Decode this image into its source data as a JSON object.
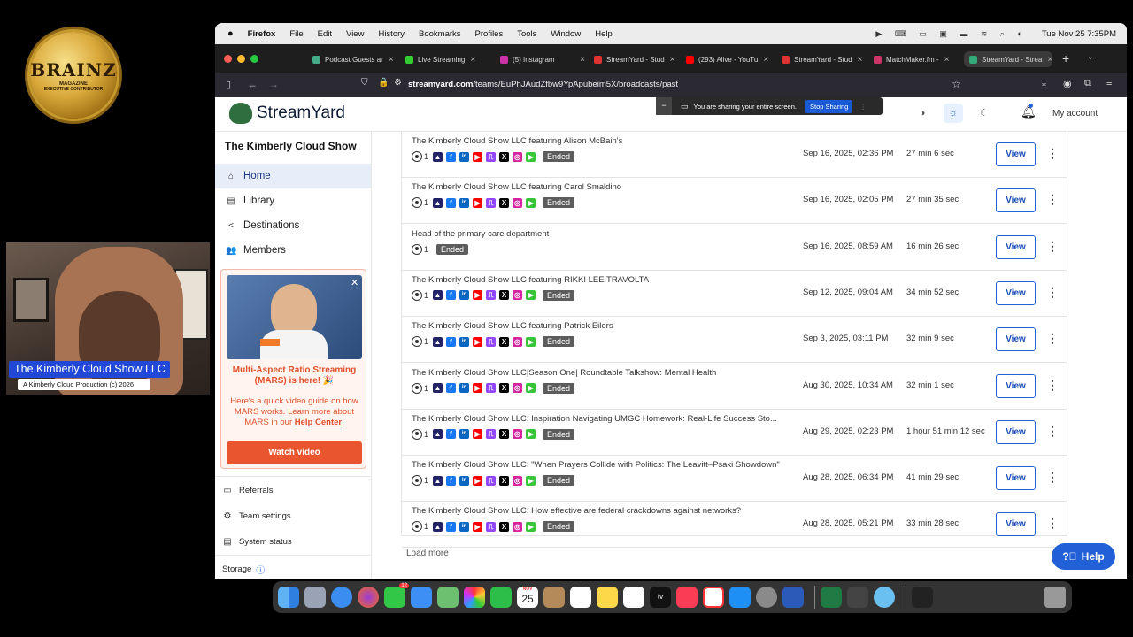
{
  "overlay": {
    "badge_title": "BRAINZ",
    "badge_line1": "MAGAZINE",
    "badge_line2": "EXECUTIVE CONTRIBUTOR",
    "lower_third_name": "The Kimberly Cloud Show LLC",
    "lower_third_sub": "A Kimberly Cloud Production (c) 2026"
  },
  "menubar": {
    "app": "Firefox",
    "items": [
      "File",
      "Edit",
      "View",
      "History",
      "Bookmarks",
      "Profiles",
      "Tools",
      "Window",
      "Help"
    ],
    "datetime": "Tue Nov 25  7:35PM"
  },
  "tabs": [
    {
      "label": "Podcast Guests ar",
      "color": "#4a8"
    },
    {
      "label": "Live Streaming",
      "color": "#3c3"
    },
    {
      "label": "(5) Instagram",
      "color": "#c3a"
    },
    {
      "label": "StreamYard - Stud",
      "color": "#d33"
    },
    {
      "label": "(293) Alive - YouTu",
      "color": "#f00"
    },
    {
      "label": "StreamYard - Stud",
      "color": "#d33"
    },
    {
      "label": "MatchMaker.fm - ",
      "color": "#c36"
    },
    {
      "label": "StreamYard - Strea",
      "color": "#3a7"
    }
  ],
  "url": {
    "domain": "streamyard.com",
    "path": "/teams/EuPhJAudZfbw9YpApubeim5X/broadcasts/past"
  },
  "header": {
    "logo_text": "StreamYard",
    "share_text": "You are sharing your entire screen.",
    "stop_sharing": "Stop Sharing",
    "my_account": "My account"
  },
  "sidebar": {
    "show_name": "The Kimberly Cloud Show",
    "nav": [
      {
        "label": "Home",
        "icon": "home-icon",
        "glyph": "⌂"
      },
      {
        "label": "Library",
        "icon": "library-icon",
        "glyph": "▤"
      },
      {
        "label": "Destinations",
        "icon": "share-icon",
        "glyph": "<"
      },
      {
        "label": "Members",
        "icon": "members-icon",
        "glyph": "👥"
      }
    ],
    "promo": {
      "title": "Multi-Aspect Ratio Streaming (MARS) is here! 🎉",
      "desc_pre": "Here's a quick video guide on how MARS works. Learn more about MARS in our ",
      "desc_link": "Help Center",
      "desc_post": ".",
      "button": "Watch video"
    },
    "bottom": [
      {
        "label": "Referrals",
        "glyph": "▭"
      },
      {
        "label": "Team settings",
        "glyph": "⚙"
      },
      {
        "label": "System status",
        "glyph": "▤"
      }
    ],
    "storage": "Storage"
  },
  "broadcasts": [
    {
      "title": "The Kimberly Cloud Show LLC featuring Alison McBain's",
      "count": "1",
      "social": true,
      "status": "Ended",
      "date": "Sep 16, 2025, 02:36 PM",
      "duration": "27 min 6 sec",
      "view": "View"
    },
    {
      "title": "The Kimberly Cloud Show LLC featuring Carol Smaldino",
      "count": "1",
      "social": true,
      "status": "Ended",
      "date": "Sep 16, 2025, 02:05 PM",
      "duration": "27 min 35 sec",
      "view": "View"
    },
    {
      "title": "Head of the primary care department",
      "count": "1",
      "social": false,
      "status": "Ended",
      "date": "Sep 16, 2025, 08:59 AM",
      "duration": "16 min 26 sec",
      "view": "View"
    },
    {
      "title": "The Kimberly Cloud Show LLC featuring RIKKI LEE TRAVOLTA",
      "count": "1",
      "social": true,
      "status": "Ended",
      "date": "Sep 12, 2025, 09:04 AM",
      "duration": "34 min 52 sec",
      "view": "View"
    },
    {
      "title": "The Kimberly Cloud Show LLC featuring Patrick Eilers",
      "count": "1",
      "social": true,
      "status": "Ended",
      "date": "Sep 3, 2025, 03:11 PM",
      "duration": "32 min 9 sec",
      "view": "View"
    },
    {
      "title": "The Kimberly Cloud Show LLC|Season One| Roundtable Talkshow: Mental Health",
      "count": "1",
      "social": true,
      "status": "Ended",
      "date": "Aug 30, 2025, 10:34 AM",
      "duration": "32 min 1 sec",
      "view": "View"
    },
    {
      "title": "The Kimberly Cloud Show LLC: Inspiration Navigating UMGC Homework: Real-Life Success Sto...",
      "count": "1",
      "social": true,
      "status": "Ended",
      "date": "Aug 29, 2025, 02:23 PM",
      "duration": "1 hour 51 min 12 sec",
      "view": "View"
    },
    {
      "title": "The Kimberly Cloud Show LLC: \"When Prayers Collide with Politics: The Leavitt–Psaki Showdown\"",
      "count": "1",
      "social": true,
      "status": "Ended",
      "date": "Aug 28, 2025, 06:34 PM",
      "duration": "41 min 29 sec",
      "view": "View"
    },
    {
      "title": "The Kimberly Cloud Show LLC: How effective are federal crackdowns against networks?",
      "count": "1",
      "social": true,
      "status": "Ended",
      "date": "Aug 28, 2025, 05:21 PM",
      "duration": "33 min 28 sec",
      "view": "View"
    }
  ],
  "load_more": "Load more",
  "help": "Help",
  "dock": {
    "calendar_month": "NOV",
    "calendar_day": "25",
    "tv_label": "tv",
    "mail_badge": "12"
  }
}
